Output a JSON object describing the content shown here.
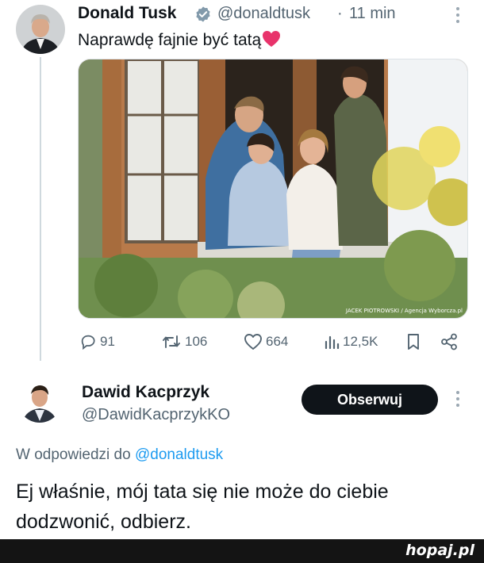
{
  "tweet": {
    "author_name": "Donald Tusk",
    "author_handle": "@donaldtusk",
    "separator": "·",
    "time": "11 min",
    "text": "Naprawdę fajnie być tatą",
    "photo_credit": "JACEK PIOTROWSKI / Agencja Wyborcza.pl",
    "stats": {
      "replies": "91",
      "reposts": "106",
      "likes": "664",
      "views": "12,5K"
    },
    "accent": "#1d9bf0"
  },
  "reply": {
    "author_name": "Dawid Kacprzyk",
    "author_handle": "@DawidKacprzykKO",
    "follow_label": "Obserwuj",
    "in_reply_prefix": "W odpowiedzi do",
    "in_reply_mention": "@donaldtusk",
    "text": "Ej właśnie, mój tata się nie może do ciebie dodzwonić, odbierz."
  },
  "footer": {
    "watermark": "hopaj.pl"
  }
}
